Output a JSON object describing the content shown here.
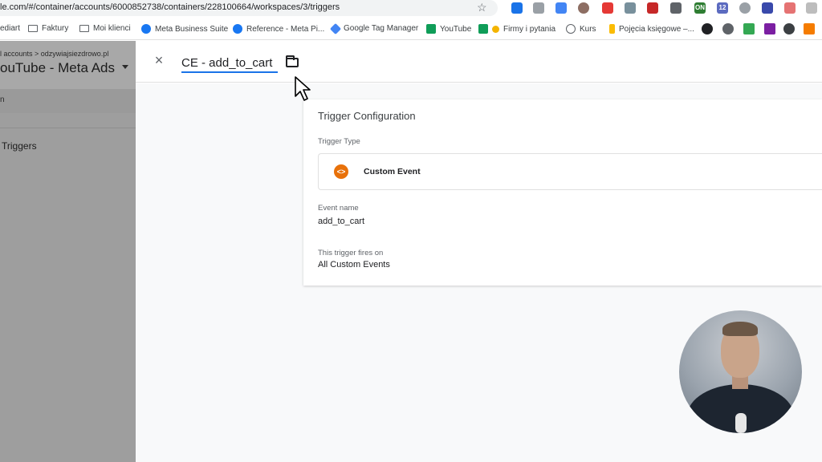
{
  "browser": {
    "url": "le.com/#/container/accounts/6000852738/containers/228100664/workspaces/3/triggers",
    "bookmarks": [
      {
        "label": "ediart",
        "icon": "bookmark-icon"
      },
      {
        "label": "Faktury",
        "icon": "folder-icon"
      },
      {
        "label": "Moi klienci",
        "icon": "folder-icon"
      },
      {
        "label": "Meta Business Suite",
        "icon": "meta-icon"
      },
      {
        "label": "Reference - Meta Pi...",
        "icon": "facebook-icon"
      },
      {
        "label": "Google Tag Manager",
        "icon": "gtm-icon"
      },
      {
        "label": "YouTube",
        "icon": "sheets-icon"
      },
      {
        "label": "Firmy i pytania",
        "icon": "sheets-star-icon"
      },
      {
        "label": "Kurs",
        "icon": "kurs-icon"
      },
      {
        "label": "Pojęcia księgowe –...",
        "icon": "doc-icon"
      }
    ],
    "extension_badges": {
      "on": "ON",
      "count": "12"
    }
  },
  "workspace": {
    "breadcrumb": "l accounts > odzywiajsiezdrowo.pl",
    "title": "ouTube - Meta Ads",
    "sub": "n",
    "nav_label": "Triggers"
  },
  "editor": {
    "trigger_name": "CE - add_to_cart",
    "close_label": "×",
    "config": {
      "title": "Trigger Configuration",
      "type_label": "Trigger Type",
      "type_icon_glyph": "<>",
      "type_name": "Custom Event",
      "event_name_label": "Event name",
      "event_name_value": "add_to_cart",
      "fires_on_label": "This trigger fires on",
      "fires_on_value": "All Custom Events"
    }
  },
  "colors": {
    "accent": "#1a73e8",
    "custom_event": "#e8710a"
  }
}
